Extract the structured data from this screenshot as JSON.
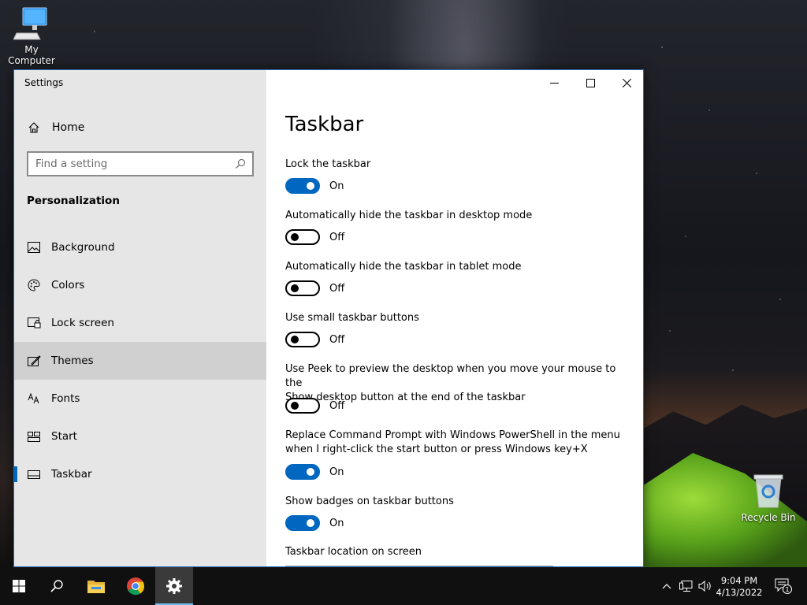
{
  "desktop": {
    "icons": [
      {
        "label": "My Computer"
      },
      {
        "label": "Recycle Bin"
      }
    ]
  },
  "window": {
    "app_title": "Settings",
    "controls": {
      "minimize": "minimize-icon",
      "maximize": "maximize-icon",
      "close": "close-icon"
    }
  },
  "sidebar": {
    "home_label": "Home",
    "search_placeholder": "Find a setting",
    "section_heading": "Personalization",
    "items": [
      {
        "label": "Background",
        "icon": "image-icon"
      },
      {
        "label": "Colors",
        "icon": "palette-icon"
      },
      {
        "label": "Lock screen",
        "icon": "lock-screen-icon"
      },
      {
        "label": "Themes",
        "icon": "themes-icon"
      },
      {
        "label": "Fonts",
        "icon": "fonts-icon"
      },
      {
        "label": "Start",
        "icon": "start-icon"
      },
      {
        "label": "Taskbar",
        "icon": "taskbar-icon"
      }
    ],
    "hovered_item": "Themes",
    "selected_item": "Taskbar"
  },
  "content": {
    "title": "Taskbar",
    "settings": [
      {
        "label": "Lock the taskbar",
        "state": "On"
      },
      {
        "label": "Automatically hide the taskbar in desktop mode",
        "state": "Off"
      },
      {
        "label": "Automatically hide the taskbar in tablet mode",
        "state": "Off"
      },
      {
        "label": "Use small taskbar buttons",
        "state": "Off"
      },
      {
        "label_line1": "Use Peek to preview the desktop when you move your mouse to the",
        "label_line2": "Show desktop button at the end of the taskbar",
        "state": "Off"
      },
      {
        "label_line1": "Replace Command Prompt with Windows PowerShell in the menu",
        "label_line2": "when I right-click the start button or press Windows key+X",
        "state": "On"
      },
      {
        "label": "Show badges on taskbar buttons",
        "state": "On"
      }
    ],
    "location_label": "Taskbar location on screen"
  },
  "taskbar": {
    "apps": [
      "start-button",
      "search-button",
      "file-explorer",
      "chrome",
      "settings"
    ],
    "time": "9:04 PM",
    "date": "4/13/2022",
    "notification_count": "1"
  },
  "colors": {
    "accent": "#0067c0",
    "sidebar_bg": "#e6e6e6",
    "taskbar_bg": "#101010"
  }
}
